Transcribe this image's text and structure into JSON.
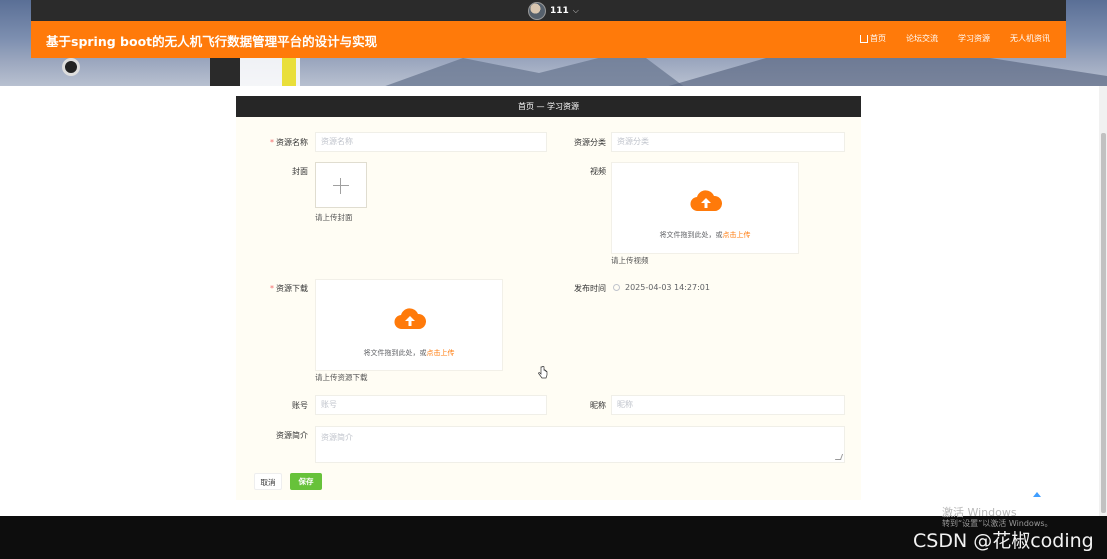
{
  "header": {
    "username": "111",
    "site_title": "基于spring boot的无人机飞行数据管理平台的设计与实现",
    "nav": [
      {
        "label": "首页",
        "icon": "home-icon"
      },
      {
        "label": "论坛交流"
      },
      {
        "label": "学习资源"
      },
      {
        "label": "无人机资讯"
      }
    ]
  },
  "breadcrumb": "首页 — 学习资源",
  "form": {
    "name": {
      "label": "资源名称",
      "placeholder": "资源名称"
    },
    "category": {
      "label": "资源分类",
      "placeholder": "资源分类"
    },
    "cover": {
      "label": "封面",
      "hint": "请上传封面"
    },
    "video": {
      "label": "视频",
      "hint": "请上传视频",
      "drop_text": "将文件拖到此处，或",
      "drop_link": "点击上传"
    },
    "download": {
      "label": "资源下载",
      "hint": "请上传资源下载",
      "drop_text": "将文件拖到此处，或",
      "drop_link": "点击上传"
    },
    "publish_time": {
      "label": "发布时间",
      "value": "2025-04-03 14:27:01"
    },
    "account": {
      "label": "账号",
      "placeholder": "账号"
    },
    "nickname": {
      "label": "昵称",
      "placeholder": "昵称"
    },
    "intro": {
      "label": "资源简介",
      "placeholder": "资源简介"
    },
    "cancel_label": "取消",
    "save_label": "保存"
  },
  "overlay": {
    "activate_title": "激活 Windows",
    "activate_sub": "转到“设置”以激活 Windows。",
    "watermark": "CSDN @花椒coding"
  },
  "colors": {
    "accent": "#ff7a0a",
    "save_button": "#67c23a",
    "header_dark": "#2b2b2b"
  }
}
